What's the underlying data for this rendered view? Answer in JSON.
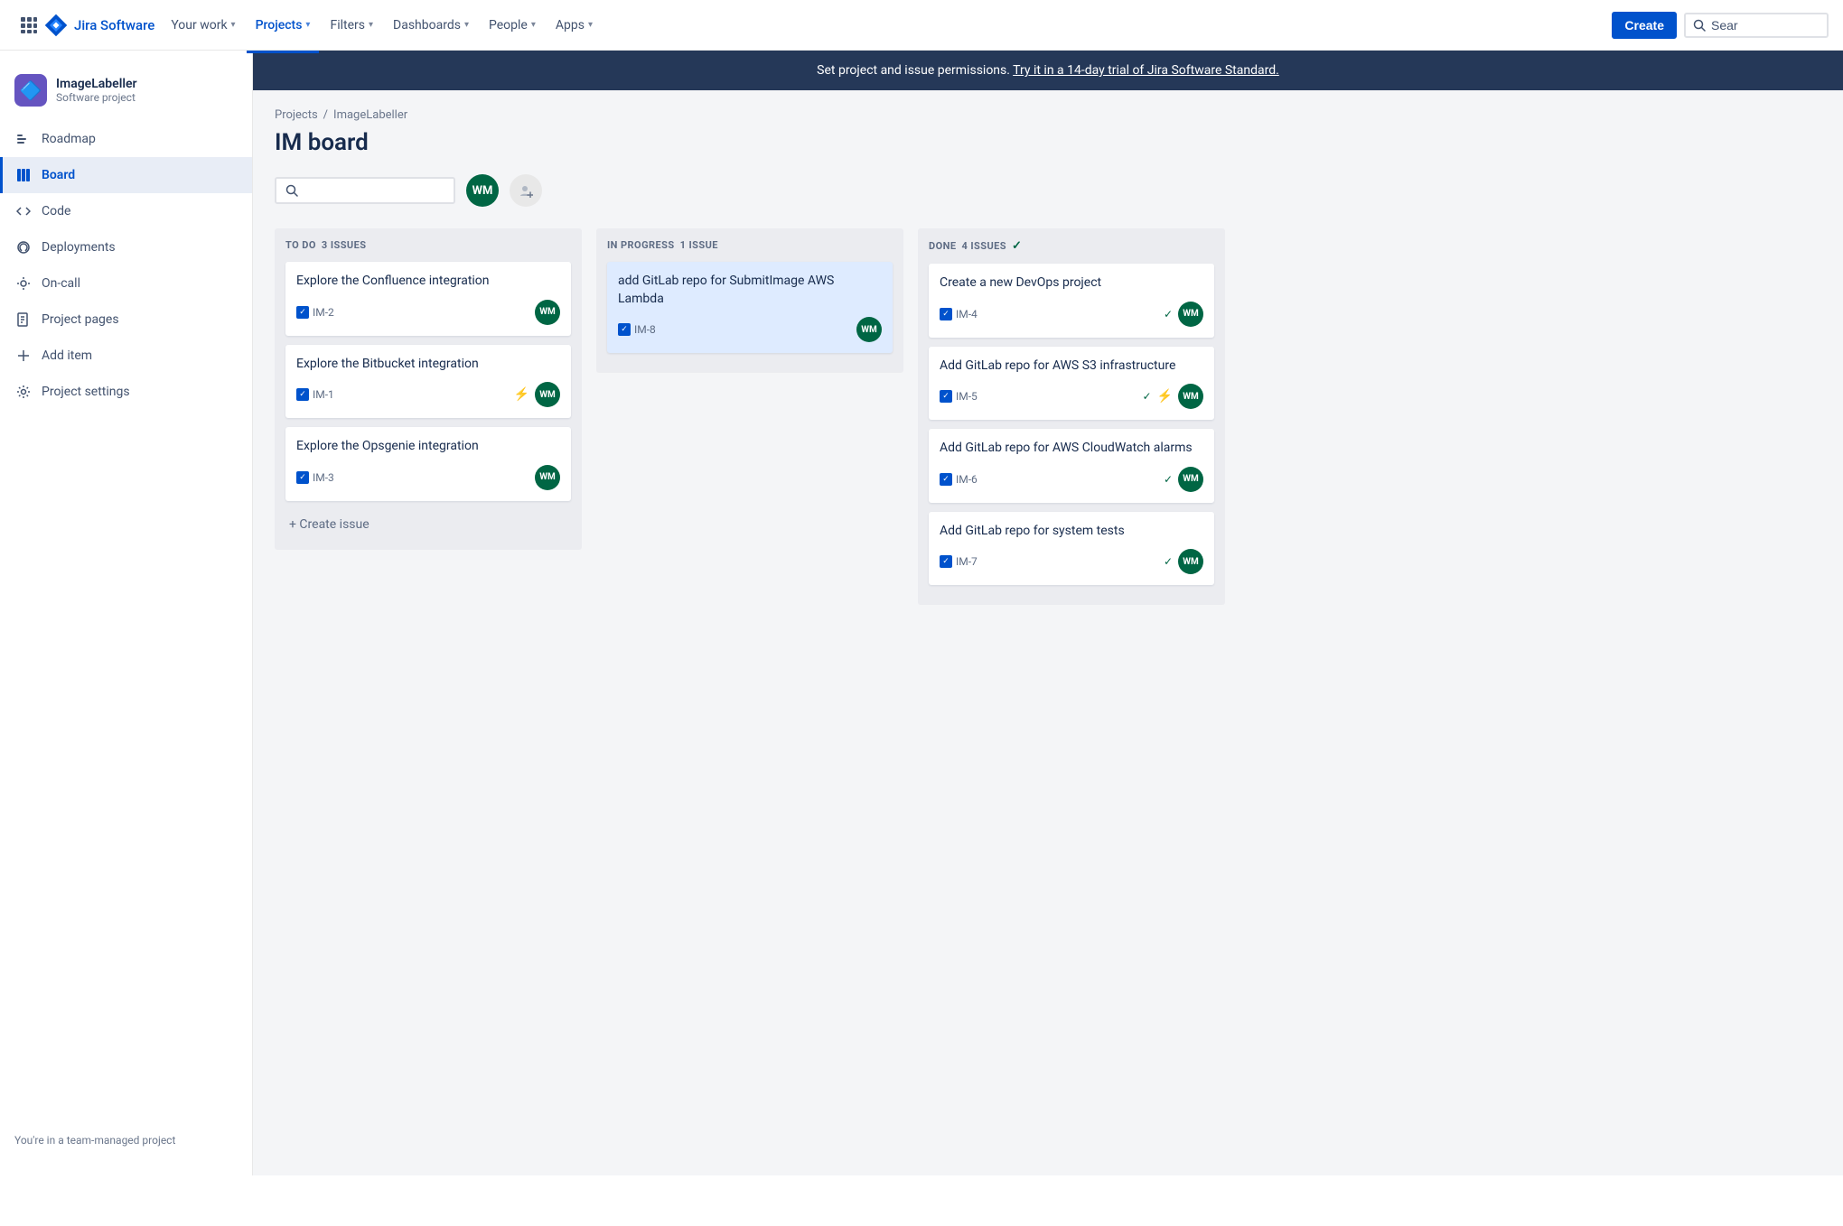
{
  "topnav": {
    "logo_text": "Jira Software",
    "nav_items": [
      {
        "label": "Your work",
        "key": "your-work"
      },
      {
        "label": "Projects",
        "key": "projects",
        "active": true
      },
      {
        "label": "Filters",
        "key": "filters"
      },
      {
        "label": "Dashboards",
        "key": "dashboards"
      },
      {
        "label": "People",
        "key": "people"
      },
      {
        "label": "Apps",
        "key": "apps"
      }
    ],
    "create_label": "Create",
    "search_placeholder": "Sear"
  },
  "sidebar": {
    "project_name": "ImageLabeller",
    "project_type": "Software project",
    "avatar_emoji": "🔷",
    "nav_items": [
      {
        "label": "Roadmap",
        "icon": "≡",
        "key": "roadmap"
      },
      {
        "label": "Board",
        "icon": "⊞",
        "key": "board",
        "active": true
      },
      {
        "label": "Code",
        "icon": "</>",
        "key": "code"
      },
      {
        "label": "Deployments",
        "icon": "☁",
        "key": "deployments"
      },
      {
        "label": "On-call",
        "icon": "⚙",
        "key": "on-call"
      },
      {
        "label": "Project pages",
        "icon": "📄",
        "key": "project-pages"
      },
      {
        "label": "Add item",
        "icon": "+",
        "key": "add-item"
      },
      {
        "label": "Project settings",
        "icon": "⚙",
        "key": "project-settings"
      }
    ],
    "footer_text": "You're in a team-managed project"
  },
  "banner": {
    "text": "Set project and issue permissions.",
    "link_text": "Try it in a 14-day trial of Jira Software Standard."
  },
  "breadcrumb": {
    "items": [
      "Projects",
      "ImageLabeller"
    ]
  },
  "page_title": "IM board",
  "board_search_placeholder": "",
  "avatar_initials": "WM",
  "columns": [
    {
      "key": "todo",
      "title": "TO DO",
      "issue_count": "3 ISSUES",
      "done_icon": false,
      "cards": [
        {
          "key": "card-im2",
          "title": "Explore the Confluence integration",
          "id": "IM-2",
          "has_pin": false,
          "highlighted": false
        },
        {
          "key": "card-im1",
          "title": "Explore the Bitbucket integration",
          "id": "IM-1",
          "has_pin": true,
          "highlighted": false
        },
        {
          "key": "card-im3",
          "title": "Explore the Opsgenie integration",
          "id": "IM-3",
          "has_pin": false,
          "highlighted": false
        }
      ],
      "create_issue_label": "+ Create issue"
    },
    {
      "key": "inprogress",
      "title": "IN PROGRESS",
      "issue_count": "1 ISSUE",
      "done_icon": false,
      "cards": [
        {
          "key": "card-im8",
          "title": "add GitLab repo for SubmitImage AWS Lambda",
          "id": "IM-8",
          "has_pin": false,
          "highlighted": true
        }
      ],
      "create_issue_label": null
    },
    {
      "key": "done",
      "title": "DONE",
      "issue_count": "4 ISSUES",
      "done_icon": true,
      "cards": [
        {
          "key": "card-im4",
          "title": "Create a new DevOps project",
          "id": "IM-4",
          "has_pin": false,
          "highlighted": false
        },
        {
          "key": "card-im5",
          "title": "Add GitLab repo for AWS S3 infrastructure",
          "id": "IM-5",
          "has_pin": true,
          "highlighted": false
        },
        {
          "key": "card-im6",
          "title": "Add GitLab repo for AWS CloudWatch alarms",
          "id": "IM-6",
          "has_pin": false,
          "highlighted": false
        },
        {
          "key": "card-im7",
          "title": "Add GitLab repo for system tests",
          "id": "IM-7",
          "has_pin": false,
          "highlighted": false
        }
      ],
      "create_issue_label": null
    }
  ]
}
